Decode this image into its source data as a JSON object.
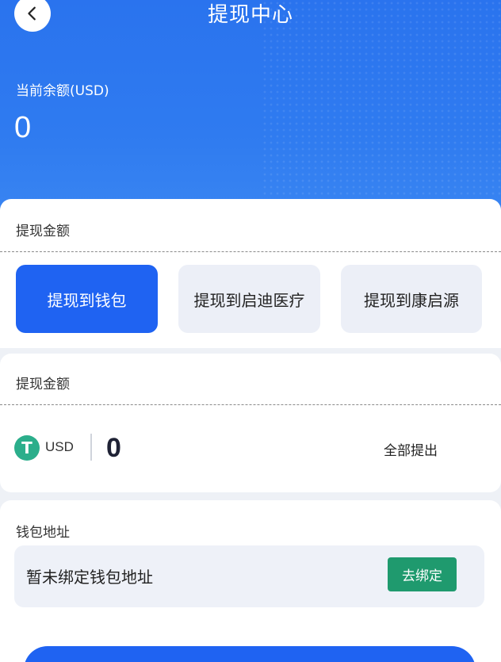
{
  "header": {
    "title": "提现中心",
    "balance_label": "当前余额(USD)",
    "balance_value": "0"
  },
  "withdraw_target": {
    "section_title": "提现金额",
    "options": [
      {
        "label": "提现到钱包",
        "selected": true
      },
      {
        "label": "提现到启迪医疗",
        "selected": false
      },
      {
        "label": "提现到康启源",
        "selected": false
      }
    ]
  },
  "amount": {
    "section_title": "提现金额",
    "currency_icon_glyph": "T",
    "currency": "USD",
    "value": "0",
    "withdraw_all_label": "全部提出"
  },
  "wallet": {
    "section_title": "钱包地址",
    "status_text": "暂未绑定钱包地址",
    "bind_label": "去绑定"
  },
  "colors": {
    "primary": "#1f63f2",
    "header_blue": "#2f7bf0",
    "bind_green": "#1f9a6e",
    "usdt_green": "#2bae8b"
  }
}
